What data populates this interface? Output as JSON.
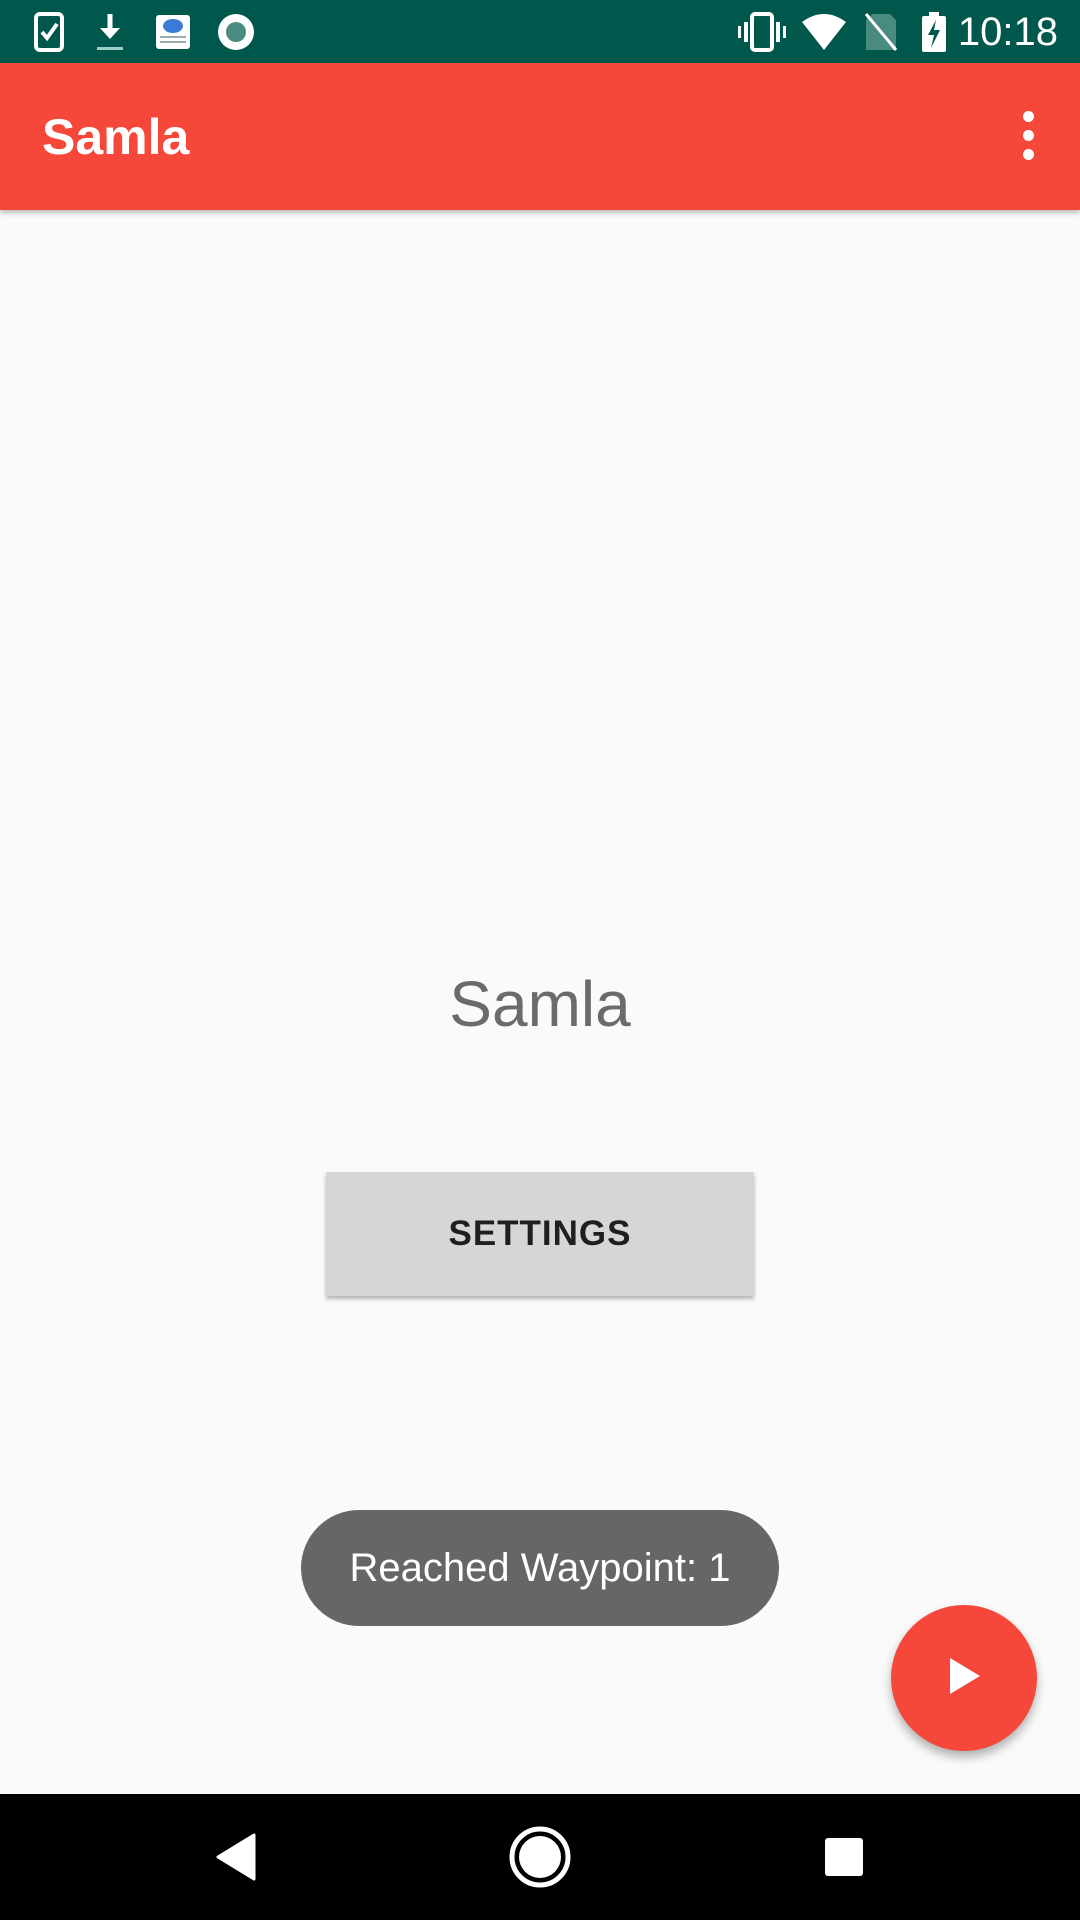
{
  "status_bar": {
    "time": "10:18",
    "left_icons": [
      "task-check-icon",
      "download-icon",
      "test-app-icon",
      "record-icon"
    ],
    "right_icons": [
      "vibrate-icon",
      "wifi-icon",
      "no-sim-icon",
      "battery-charging-icon"
    ],
    "background": "#00574b"
  },
  "app_bar": {
    "title": "Samla",
    "overflow_icon": "more-vert-icon",
    "background": "#f5473a"
  },
  "main": {
    "title": "Samla",
    "settings_label": "SETTINGS"
  },
  "toast": {
    "text": "Reached Waypoint: 1"
  },
  "fab": {
    "icon": "play-icon",
    "color": "#f5473a"
  },
  "nav_bar": {
    "back_icon": "back-icon",
    "home_icon": "home-icon",
    "recents_icon": "recents-icon"
  }
}
